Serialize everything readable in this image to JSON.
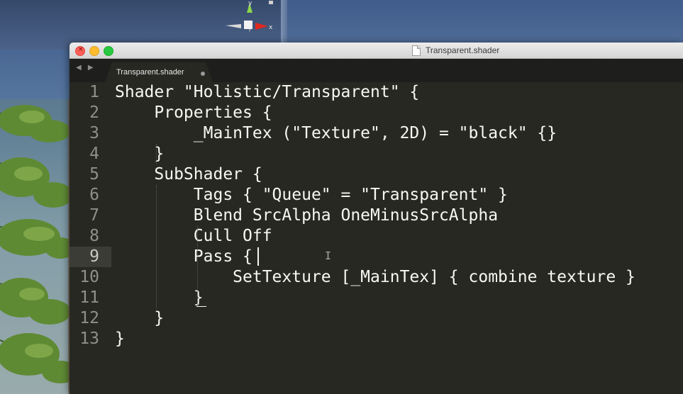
{
  "scene": {
    "gizmo_axis_y": "y",
    "gizmo_axis_x": "x"
  },
  "window": {
    "title": "Transparent.shader",
    "tab_label": "Transparent.shader",
    "tab_nav": "◀ ▶"
  },
  "editor": {
    "current_line": 9,
    "lines": [
      {
        "n": "1",
        "text": "Shader \"Holistic/Transparent\" {"
      },
      {
        "n": "2",
        "text": "    Properties {"
      },
      {
        "n": "3",
        "text": "        _MainTex (\"Texture\", 2D) = \"black\" {}"
      },
      {
        "n": "4",
        "text": "    }"
      },
      {
        "n": "5",
        "text": "    SubShader {"
      },
      {
        "n": "6",
        "text": "        Tags { \"Queue\" = \"Transparent\" }"
      },
      {
        "n": "7",
        "text": "        Blend SrcAlpha OneMinusSrcAlpha"
      },
      {
        "n": "8",
        "text": "        Cull Off"
      },
      {
        "n": "9",
        "text": "        Pass {"
      },
      {
        "n": "10",
        "text": "            SetTexture [_MainTex] { combine texture }"
      },
      {
        "n": "11",
        "text": "        }"
      },
      {
        "n": "12",
        "text": "    }"
      },
      {
        "n": "13",
        "text": "}"
      }
    ]
  },
  "colors": {
    "editor_bg": "#272822",
    "text": "#f8f8f2",
    "line_number": "#8f908a",
    "close": "#ff5f57",
    "minimize": "#ffbd2e",
    "maximize": "#28c940"
  },
  "icons": [
    "close-icon",
    "minimize-icon",
    "maximize-icon",
    "document-icon",
    "modified-dot-icon",
    "text-cursor-icon"
  ]
}
